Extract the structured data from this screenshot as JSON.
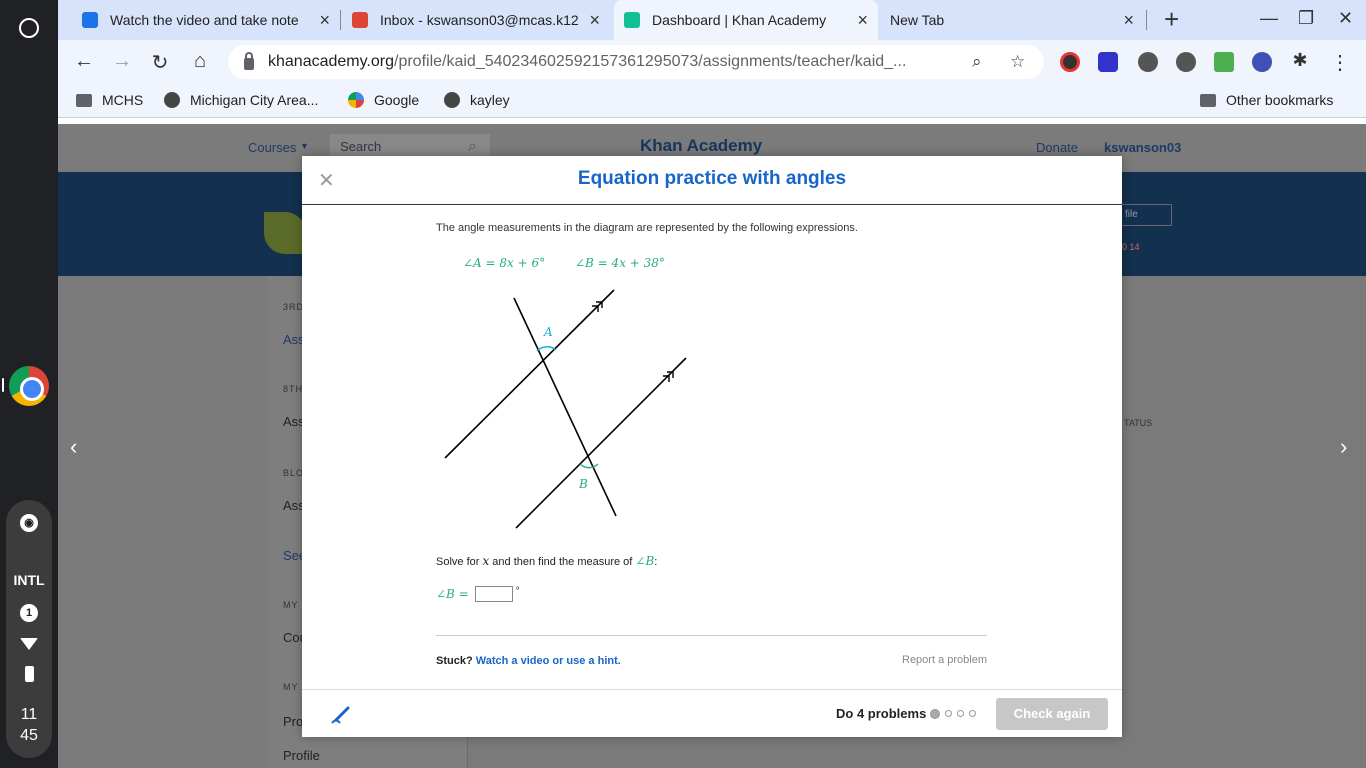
{
  "shelf": {
    "ime_label": "INTL",
    "notification_count": "1",
    "clock_hour": "11",
    "clock_minute": "45"
  },
  "tabs": [
    {
      "title": "Watch the video and take note",
      "icon": "google-classroom-icon",
      "color": "#1a73e8",
      "active": false
    },
    {
      "title": "Inbox - kswanson03@mcas.k12",
      "icon": "gmail-icon",
      "color": "#db4437",
      "active": false
    },
    {
      "title": "Dashboard | Khan Academy",
      "icon": "khan-academy-icon",
      "color": "#14bf96",
      "active": true
    },
    {
      "title": "New Tab",
      "icon": "",
      "color": "",
      "active": false
    }
  ],
  "omnibox": {
    "host": "khanacademy.org",
    "path": "/profile/kaid_540234602592157361295073/assignments/teacher/kaid_..."
  },
  "bookmarks": [
    {
      "label": "MCHS"
    },
    {
      "label": "Michigan City Area..."
    },
    {
      "label": "Google"
    },
    {
      "label": "kayley"
    }
  ],
  "other_bookmarks": "Other bookmarks",
  "background_page": {
    "courses": "Courses",
    "search": "Search",
    "logo": "Khan Academy",
    "donate": "Donate",
    "username": "kswanson03",
    "profile_btn": "file",
    "stats": "0 14",
    "status_header": "TATUS",
    "sidebar": [
      {
        "label": "3RD",
        "item": "Ass"
      },
      {
        "label": "8TH",
        "item": "Ass"
      },
      {
        "label": "BLO",
        "item": "Ass"
      },
      {
        "label": "",
        "item": "See"
      },
      {
        "label": "MY",
        "item": "Cou"
      },
      {
        "label": "MY",
        "item": "Pro"
      },
      {
        "label": "",
        "item": "Profile"
      }
    ]
  },
  "modal": {
    "title": "Equation practice with angles",
    "prompt": "The angle measurements in the diagram are represented by the following expressions.",
    "expr_a": "∠A = 8x + 6°",
    "expr_b": "∠B = 4x + 38°",
    "label_a": "A",
    "label_b": "B",
    "solve_prefix": "Solve for ",
    "solve_var": "x",
    "solve_mid": " and then find the measure of ",
    "solve_angle": "∠B",
    "solve_suffix": ":",
    "answer_lhs": "∠B =",
    "answer_unit": "°",
    "stuck_label": "Stuck?",
    "stuck_link": "Watch a video or use a hint.",
    "report": "Report a problem",
    "do_label": "Do 4 problems",
    "check_button": "Check again"
  }
}
